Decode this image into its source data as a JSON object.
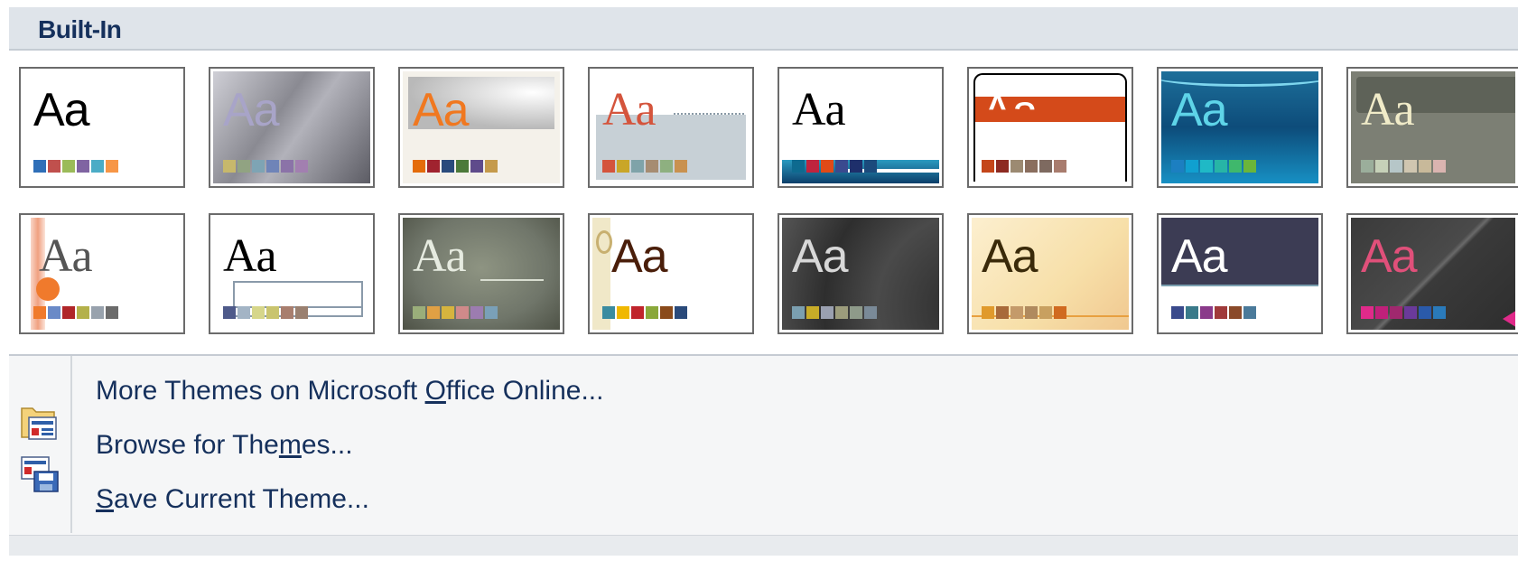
{
  "header": {
    "title": "Built-In"
  },
  "themes": [
    {
      "aa": "Aa",
      "swatches": [
        "#2f6fb8",
        "#c0504d",
        "#9bbb59",
        "#8064a2",
        "#4bacc6",
        "#f79646"
      ]
    },
    {
      "aa": "Aa",
      "swatches": [
        "#c7b86c",
        "#91a382",
        "#7ea4b4",
        "#6f84b8",
        "#8b73a8",
        "#a27fb0"
      ]
    },
    {
      "aa": "Aa",
      "swatches": [
        "#e46c0a",
        "#a0232f",
        "#2a4b7c",
        "#4c7a3a",
        "#5f4b8b",
        "#c59a4b"
      ]
    },
    {
      "aa": "Aa",
      "swatches": [
        "#d4543c",
        "#c9a628",
        "#7fa3a9",
        "#a68c72",
        "#8eb080",
        "#c9914f"
      ]
    },
    {
      "aa": "Aa",
      "swatches": [
        "#0e6a8f",
        "#c0243e",
        "#e04a17",
        "#3a4a8f",
        "#1e2f6b",
        "#1b4a7c"
      ]
    },
    {
      "aa": "Aa",
      "swatches": [
        "#c4461a",
        "#8d2a22",
        "#9c8a72",
        "#8a6e5e",
        "#7e6a60",
        "#a87c6e"
      ]
    },
    {
      "aa": "Aa",
      "swatches": [
        "#1c7fc1",
        "#10a0d0",
        "#1fb9c6",
        "#27b5a6",
        "#3fb86c",
        "#6bb53a"
      ]
    },
    {
      "aa": "Aa",
      "swatches": [
        "#9bae9b",
        "#c6d1b8",
        "#b6c6c8",
        "#d0c6b0",
        "#c8b99a",
        "#dab4b0"
      ]
    },
    {
      "aa": "Aa",
      "swatches": [
        "#f07a2c",
        "#6a8ac7",
        "#b0262a",
        "#b4b14a",
        "#98a2ad",
        "#6b6b6b"
      ]
    },
    {
      "aa": "Aa",
      "swatches": [
        "#4e5a8a",
        "#a3b4c5",
        "#d6d68a",
        "#c9c46e",
        "#a87e6e",
        "#9a8070"
      ]
    },
    {
      "aa": "Aa",
      "swatches": [
        "#9aae7a",
        "#e0a044",
        "#d6b43e",
        "#d08a8a",
        "#9c7cb0",
        "#7aa0b8"
      ]
    },
    {
      "aa": "Aa",
      "swatches": [
        "#3b8ca0",
        "#f0b800",
        "#c0242c",
        "#8aa83a",
        "#8a4a1a",
        "#2a4a7a"
      ]
    },
    {
      "aa": "Aa",
      "swatches": [
        "#7b9fb0",
        "#c8ac28",
        "#9aa0b0",
        "#9c9c7c",
        "#8e9a8a",
        "#7a8a98"
      ]
    },
    {
      "aa": "Aa",
      "swatches": [
        "#e09a2c",
        "#a86a3a",
        "#c49a6a",
        "#b08a5e",
        "#c8a060",
        "#d06a20"
      ]
    },
    {
      "aa": "Aa",
      "swatches": [
        "#3a4a8c",
        "#3a7a8a",
        "#8a3a8a",
        "#a03a3a",
        "#8a4a2a",
        "#4a7a9a"
      ]
    },
    {
      "aa": "Aa",
      "swatches": [
        "#e02a8a",
        "#c0207a",
        "#a0286e",
        "#6a3a9a",
        "#2a5aaa",
        "#2a7aba"
      ]
    }
  ],
  "menu": {
    "more": {
      "pre": "More Themes on Microsoft ",
      "u": "O",
      "post": "ffice Online..."
    },
    "browse": {
      "pre": "Browse for The",
      "u": "m",
      "post": "es..."
    },
    "save": {
      "pre": "",
      "u": "S",
      "post": "ave Current Theme..."
    }
  },
  "icons": {
    "browse": "open-folder-icon",
    "save": "save-theme-icon"
  }
}
